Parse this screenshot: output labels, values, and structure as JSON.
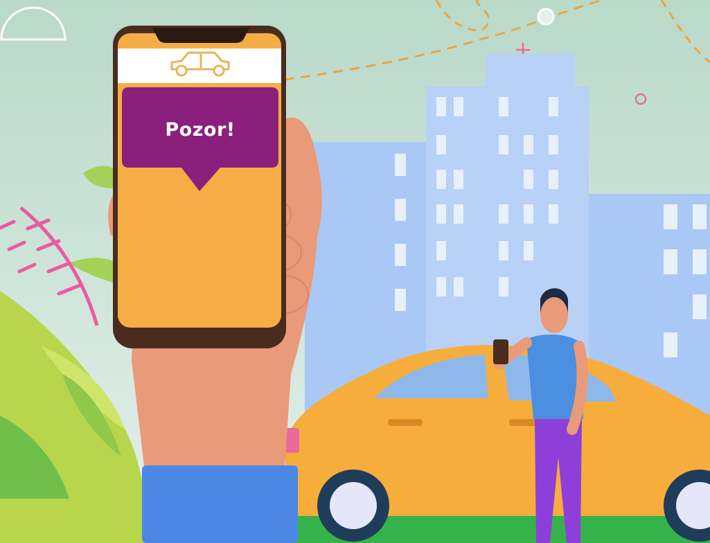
{
  "illustration": {
    "description_icons": [
      "car-icon",
      "smartphone",
      "taxi-car",
      "city-buildings",
      "man-with-phone",
      "plants"
    ],
    "bubble": {
      "text": "Pozor!"
    },
    "colors": {
      "sky_top": "#b9d9c9",
      "sky_bottom": "#e4f0ea",
      "building": "#a9c8f5",
      "building_light": "#c6dbf9",
      "phone_screen": "#f6ad45",
      "phone_frame": "#4a2c1e",
      "bubble": "#8a1f7c",
      "taxi": "#f7ad3c",
      "skin": "#e99a78",
      "sleeve": "#4b88e6",
      "shirt": "#4a8fe0",
      "pants": "#8e3fd9",
      "route": "#f2a33a",
      "ground": "#35b34a"
    }
  }
}
